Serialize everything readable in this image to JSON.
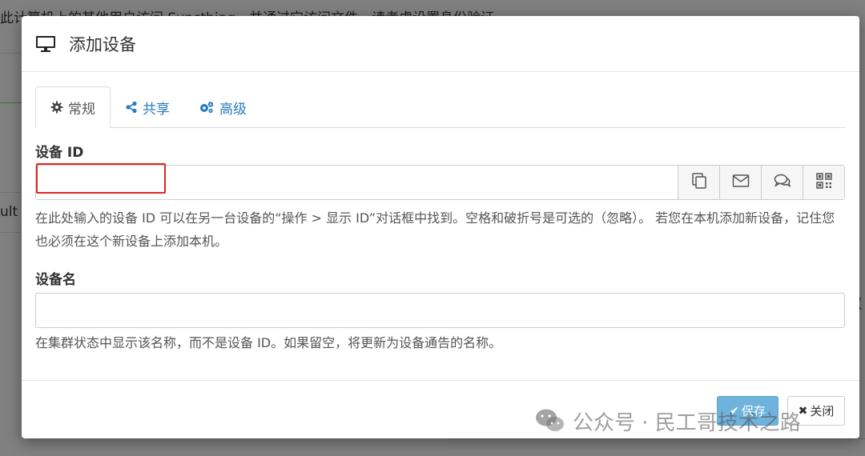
{
  "background": {
    "top_text": "此计算机上的其他用户访问 Syncthing，并通过它访问文件，请考虑设置身份验证。",
    "side_text": "ult"
  },
  "modal": {
    "title": "添加设备",
    "title_icon": "monitor-icon",
    "tabs": [
      {
        "label": "常规",
        "icon": "gear-icon",
        "active": true
      },
      {
        "label": "共享",
        "icon": "share-icon",
        "active": false
      },
      {
        "label": "高级",
        "icon": "gears-icon",
        "active": false
      }
    ],
    "device_id": {
      "label": "设备 ID",
      "value": "",
      "help": "在此处输入的设备 ID 可以在另一台设备的“操作 > 显示 ID”对话框中找到。空格和破折号是可选的（忽略）。 若您在本机添加新设备，记住您也必须在这个新设备上添加本机。",
      "addons": [
        "copy-icon",
        "envelope-icon",
        "comment-icon",
        "qrcode-icon"
      ]
    },
    "device_name": {
      "label": "设备名",
      "value": "",
      "help": "在集群状态中显示该名称，而不是设备 ID。如果留空，将更新为设备通告的名称。"
    },
    "footer": {
      "save_label": "保存",
      "close_label": "关闭"
    }
  },
  "watermark": {
    "text": "公众号 · 民工哥技术之路"
  },
  "colors": {
    "link": "#2a7bbf",
    "highlight": "#e0271f",
    "save_button": "#6fb3dd"
  }
}
